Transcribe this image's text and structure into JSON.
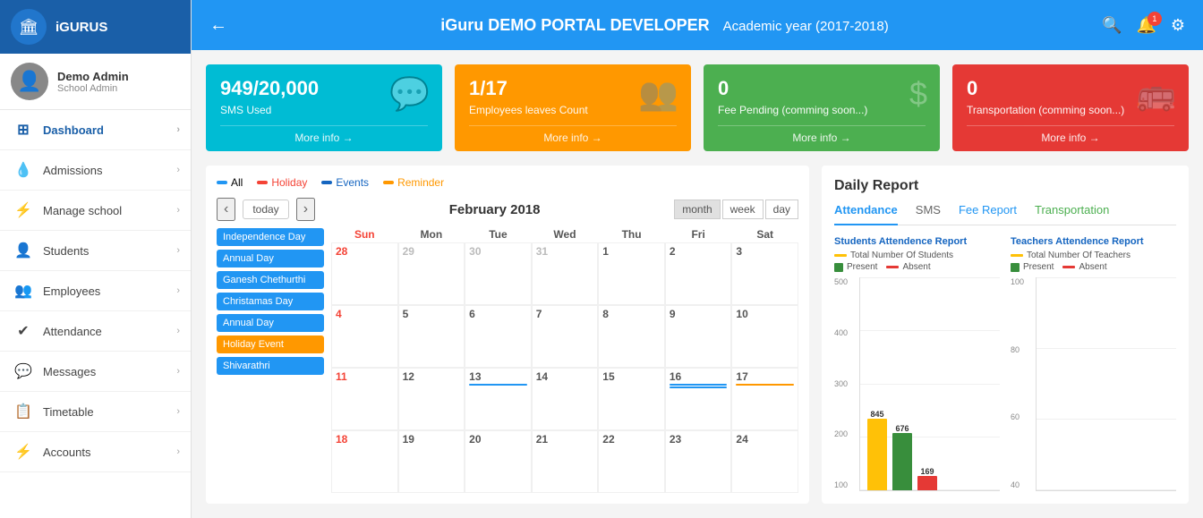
{
  "sidebar": {
    "logo": "iGURUS",
    "logo_icon": "🏛",
    "user_name": "Demo Admin",
    "user_role": "School Admin",
    "user_icon": "👤",
    "nav_items": [
      {
        "id": "dashboard",
        "label": "Dashboard",
        "icon": "⊞"
      },
      {
        "id": "admissions",
        "label": "Admissions",
        "icon": "💧"
      },
      {
        "id": "manage-school",
        "label": "Manage school",
        "icon": "⚡"
      },
      {
        "id": "students",
        "label": "Students",
        "icon": "👤"
      },
      {
        "id": "employees",
        "label": "Employees",
        "icon": "👥"
      },
      {
        "id": "attendance",
        "label": "Attendance",
        "icon": "✔"
      },
      {
        "id": "messages",
        "label": "Messages",
        "icon": "💬"
      },
      {
        "id": "timetable",
        "label": "Timetable",
        "icon": "📋"
      },
      {
        "id": "accounts",
        "label": "Accounts",
        "icon": "⚡"
      }
    ]
  },
  "header": {
    "title": "iGuru DEMO PORTAL DEVELOPER",
    "subtitle": "Academic year (2017-2018)",
    "back_label": "←",
    "notif_count": "1"
  },
  "stats": [
    {
      "id": "sms",
      "value": "949/20,000",
      "label": "SMS Used",
      "more": "More info →",
      "color": "blue",
      "icon": "💬"
    },
    {
      "id": "employees-leaves",
      "value": "1/17",
      "label": "Employees leaves Count",
      "more": "More info →",
      "color": "orange",
      "icon": "👥"
    },
    {
      "id": "fee-pending",
      "value": "0",
      "label": "Fee Pending (comming soon...)",
      "more": "More info →",
      "color": "green",
      "icon": "$"
    },
    {
      "id": "transportation",
      "value": "0",
      "label": "Transportation (comming soon...)",
      "more": "More info →",
      "color": "red",
      "icon": "🚌"
    }
  ],
  "calendar": {
    "month_title": "February 2018",
    "today_label": "today",
    "prev": "‹",
    "next": "›",
    "view_month": "month",
    "view_week": "week",
    "view_day": "day",
    "legend": [
      {
        "id": "all",
        "label": "All",
        "color": "blue"
      },
      {
        "id": "holiday",
        "label": "Holiday",
        "color": "red"
      },
      {
        "id": "events",
        "label": "Events",
        "color": "darkblue"
      },
      {
        "id": "reminder",
        "label": "Reminder",
        "color": "orange"
      }
    ],
    "events_list": [
      {
        "label": "Independence Day",
        "type": "normal"
      },
      {
        "label": "Annual Day",
        "type": "normal"
      },
      {
        "label": "Ganesh Chethurthi",
        "type": "normal"
      },
      {
        "label": "Christamas Day",
        "type": "normal"
      },
      {
        "label": "Annual Day",
        "type": "normal"
      },
      {
        "label": "Holiday Event",
        "type": "holiday"
      },
      {
        "label": "Shivarathri",
        "type": "normal"
      }
    ],
    "day_headers": [
      "Sun",
      "Mon",
      "Tue",
      "Wed",
      "Thu",
      "Fri",
      "Sat"
    ],
    "weeks": [
      [
        {
          "day": "28",
          "other": true
        },
        {
          "day": "29",
          "other": true
        },
        {
          "day": "30",
          "other": true
        },
        {
          "day": "31",
          "other": true
        },
        {
          "day": "1",
          "other": false
        },
        {
          "day": "2",
          "other": false
        },
        {
          "day": "3",
          "other": false
        }
      ],
      [
        {
          "day": "4",
          "other": false,
          "red": true
        },
        {
          "day": "5",
          "other": false
        },
        {
          "day": "6",
          "other": false
        },
        {
          "day": "7",
          "other": false
        },
        {
          "day": "8",
          "other": false
        },
        {
          "day": "9",
          "other": false
        },
        {
          "day": "10",
          "other": false
        }
      ],
      [
        {
          "day": "11",
          "other": false,
          "red": true
        },
        {
          "day": "12",
          "other": false
        },
        {
          "day": "13",
          "other": false,
          "event": true
        },
        {
          "day": "14",
          "other": false
        },
        {
          "day": "15",
          "other": false
        },
        {
          "day": "16",
          "other": false,
          "event": true
        },
        {
          "day": "17",
          "other": false,
          "event_orange": true
        }
      ],
      [
        {
          "day": "18",
          "other": false,
          "red": true
        },
        {
          "day": "19",
          "other": false
        },
        {
          "day": "20",
          "other": false
        },
        {
          "day": "21",
          "other": false
        },
        {
          "day": "22",
          "other": false
        },
        {
          "day": "23",
          "other": false
        },
        {
          "day": "24",
          "other": false
        }
      ]
    ]
  },
  "daily_report": {
    "title": "Daily Report",
    "tabs": [
      {
        "id": "attendance",
        "label": "Attendance",
        "active": true
      },
      {
        "id": "sms",
        "label": "SMS",
        "active": false
      },
      {
        "id": "fee-report",
        "label": "Fee Report",
        "active": false
      },
      {
        "id": "transportation",
        "label": "Transportation",
        "active": false
      }
    ],
    "students_chart": {
      "title": "Students Attendence Report",
      "legend": [
        {
          "label": "Total Number Of Students",
          "color": "yellow",
          "shape": "line"
        },
        {
          "label": "Present",
          "color": "green2",
          "shape": "sq"
        },
        {
          "label": "Absent",
          "color": "red2",
          "shape": "line"
        }
      ],
      "y_labels": [
        "500",
        "400",
        "300",
        "200",
        "100"
      ],
      "bars": [
        {
          "value": 845,
          "color": "yellow",
          "label": "845",
          "height_pct": 85
        },
        {
          "value": 676,
          "color": "green2",
          "label": "676",
          "height_pct": 68
        },
        {
          "value": 169,
          "color": "red2",
          "label": "169",
          "height_pct": 17
        }
      ]
    },
    "teachers_chart": {
      "title": "Teachers Attendence Report",
      "legend": [
        {
          "label": "Total Number Of Teachers",
          "color": "yellow",
          "shape": "line"
        },
        {
          "label": "Present",
          "color": "green2",
          "shape": "sq"
        },
        {
          "label": "Absent",
          "color": "red2",
          "shape": "line"
        }
      ],
      "y_labels": [
        "100",
        "80",
        "60",
        "40"
      ],
      "bars": []
    }
  }
}
